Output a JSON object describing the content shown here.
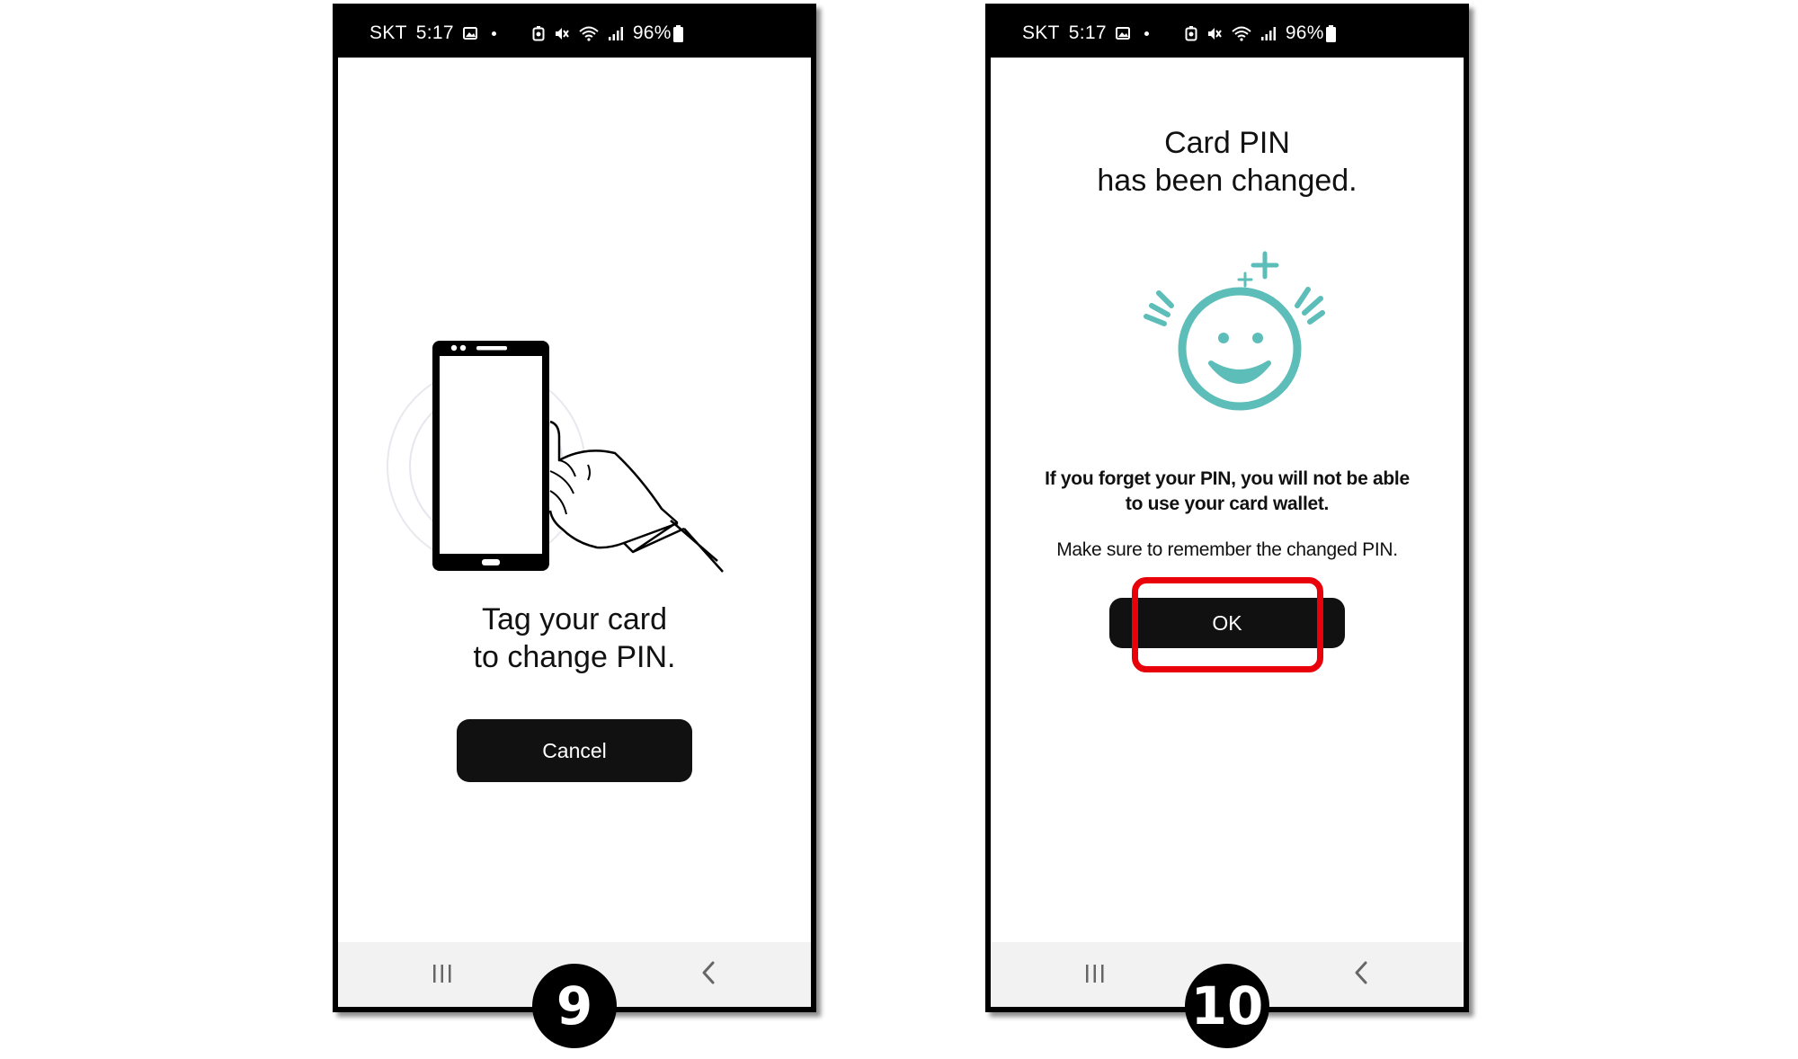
{
  "highlight_color": "#e8000a",
  "accent_color": "#5cbdb9",
  "statusbar": {
    "carrier": "SKT",
    "time": "5:17",
    "battery": "96%",
    "icons": [
      "gallery-icon",
      "dot-icon",
      "battery-saver-icon",
      "mute-icon",
      "wifi-icon",
      "signal-icon",
      "battery-icon"
    ]
  },
  "screen9": {
    "step_number": "9",
    "illustration": "hand-holding-phone-nfc",
    "message_line1": "Tag your card",
    "message_line2": "to change PIN.",
    "cancel_label": "Cancel"
  },
  "screen10": {
    "step_number": "10",
    "title_line1": "Card PIN",
    "title_line2": "has been changed.",
    "illustration": "smiling-face",
    "warning_line1": "If you forget your PIN, you will not be able",
    "warning_line2": "to use your card wallet.",
    "note": "Make sure to remember the changed PIN.",
    "ok_label": "OK"
  },
  "navbar": {
    "icons": [
      "recents-icon",
      "home-icon",
      "back-icon"
    ]
  }
}
